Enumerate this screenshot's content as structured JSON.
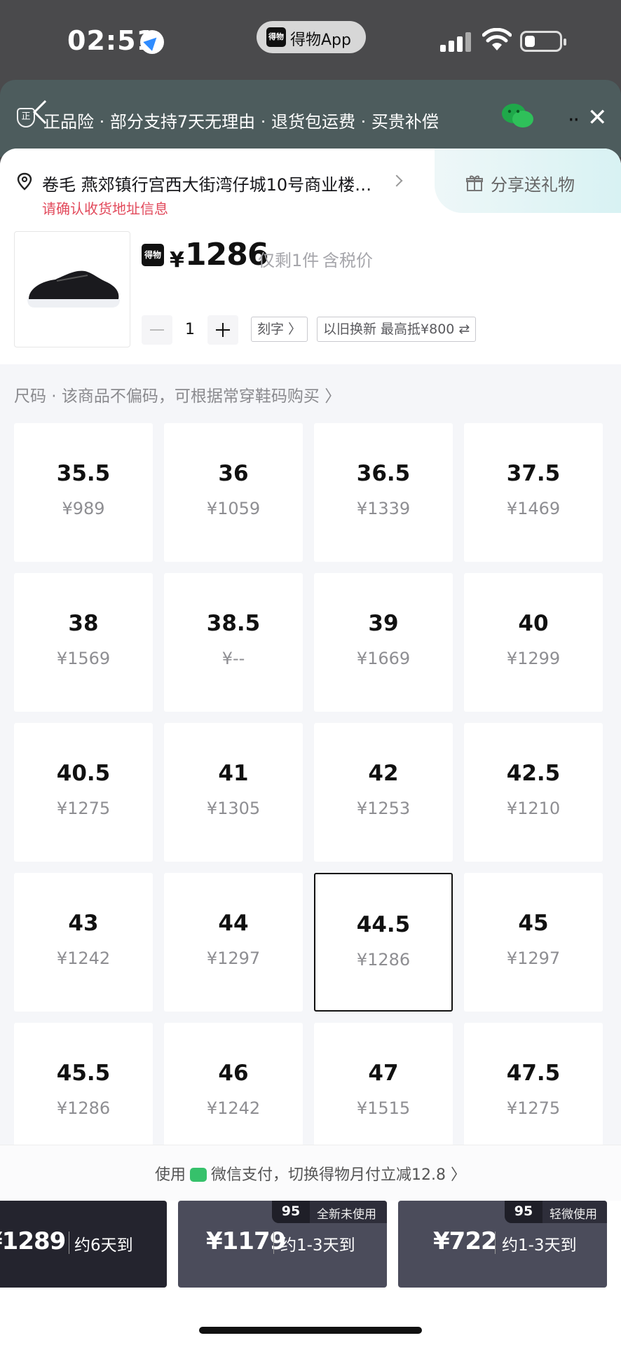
{
  "status": {
    "time": "02:51",
    "app_name": "得物App",
    "app_logo": "得物"
  },
  "guarantee": {
    "text": "正品险 · 部分支持7天无理由 · 退货包运费 · 买贵补偿",
    "shield": "正"
  },
  "address": {
    "line": "卷毛  燕郊镇行宫西大街湾仔城10号商业楼…",
    "warning": "请确认收货地址信息",
    "share_label": "分享送礼物"
  },
  "product": {
    "brand_logo": "得物",
    "currency": "¥",
    "price": "1286",
    "stock": "仅剩1件",
    "tax": "含税价",
    "quantity": "1",
    "engrave": "刻字 〉",
    "trade_in": "以旧换新  最高抵¥800 ⇄"
  },
  "size_hint": "尺码  ·  该商品不偏码，可根据常穿鞋码购买 〉",
  "sizes": [
    {
      "size": "35.5",
      "price": "¥989"
    },
    {
      "size": "36",
      "price": "¥1059"
    },
    {
      "size": "36.5",
      "price": "¥1339"
    },
    {
      "size": "37.5",
      "price": "¥1469"
    },
    {
      "size": "38",
      "price": "¥1569"
    },
    {
      "size": "38.5",
      "price": "¥--"
    },
    {
      "size": "39",
      "price": "¥1669"
    },
    {
      "size": "40",
      "price": "¥1299"
    },
    {
      "size": "40.5",
      "price": "¥1275"
    },
    {
      "size": "41",
      "price": "¥1305"
    },
    {
      "size": "42",
      "price": "¥1253"
    },
    {
      "size": "42.5",
      "price": "¥1210"
    },
    {
      "size": "43",
      "price": "¥1242"
    },
    {
      "size": "44",
      "price": "¥1297"
    },
    {
      "size": "44.5",
      "price": "¥1286"
    },
    {
      "size": "45",
      "price": "¥1297"
    },
    {
      "size": "45.5",
      "price": "¥1286"
    },
    {
      "size": "46",
      "price": "¥1242"
    },
    {
      "size": "47",
      "price": "¥1515"
    },
    {
      "size": "47.5",
      "price": "¥1275"
    }
  ],
  "selected_size": "44.5",
  "payment": {
    "prefix": "使用",
    "text": "微信支付，切换得物月付立减12.8 〉"
  },
  "buy_options": [
    {
      "price": "¥1289",
      "delivery": "约6天到"
    },
    {
      "price": "¥1179",
      "delivery": "约1-3天到",
      "grade": "95",
      "condition": "全新未使用"
    },
    {
      "price": "¥722",
      "delivery": "约1-3天到",
      "grade": "95",
      "condition": "轻微使用"
    }
  ],
  "colors": {
    "accent_red": "#e24a5c",
    "buy_dark": "#24242e",
    "buy_gray": "#4b4c5b",
    "wechat_green": "#36c16b"
  }
}
